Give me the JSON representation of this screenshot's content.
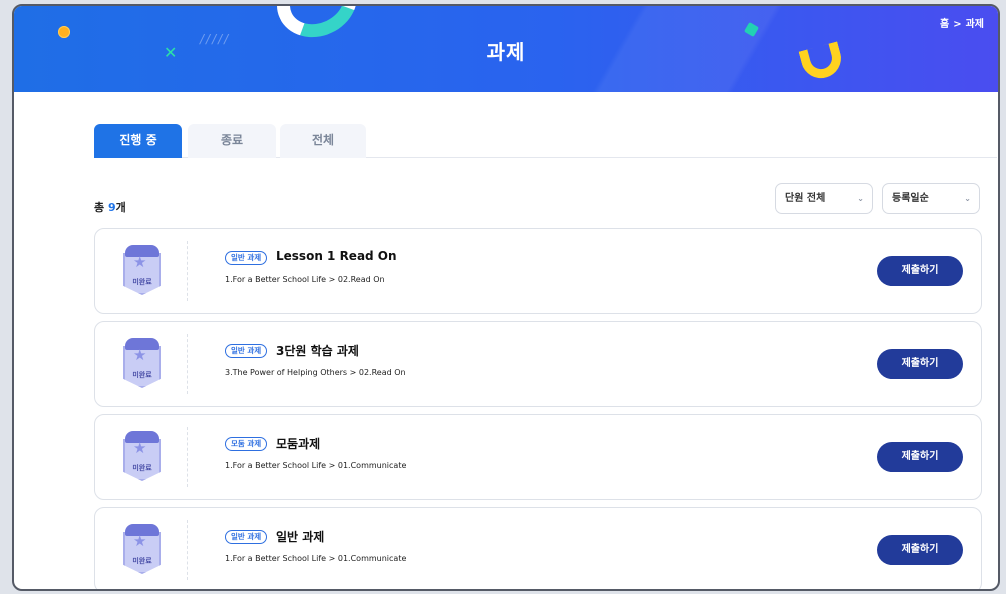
{
  "header": {
    "title": "과제",
    "breadcrumb": {
      "home": "홈",
      "separator": ">",
      "current": "과제"
    }
  },
  "tabs": [
    {
      "label": "진행 중",
      "active": true
    },
    {
      "label": "종료",
      "active": false
    },
    {
      "label": "전체",
      "active": false
    }
  ],
  "summary": {
    "prefix": "총 ",
    "count": "9",
    "suffix": "개"
  },
  "filters": {
    "unit": {
      "selected": "단원 전체"
    },
    "sort": {
      "selected": "등록일순"
    }
  },
  "assignments": [
    {
      "status": "미완료",
      "type": "일반 과제",
      "title": "Lesson 1 Read On",
      "path": "1.For a Better School Life > 02.Read On",
      "action": "제출하기"
    },
    {
      "status": "미완료",
      "type": "일반 과제",
      "title": "3단원 학습 과제",
      "path": "3.The Power of Helping Others > 02.Read On",
      "action": "제출하기"
    },
    {
      "status": "미완료",
      "type": "모둠 과제",
      "title": "모둠과제",
      "path": "1.For a Better School Life > 01.Communicate",
      "action": "제출하기"
    },
    {
      "status": "미완료",
      "type": "일반 과제",
      "title": "일반 과제",
      "path": "1.For a Better School Life > 01.Communicate",
      "action": "제출하기"
    }
  ],
  "colors": {
    "banner": "#2a63ef",
    "accent": "#1f73e6",
    "submit_button": "#223b9a",
    "badge": "#6e76d8"
  },
  "icons": {
    "chevron": "chevron-down-icon",
    "star": "star-icon"
  }
}
